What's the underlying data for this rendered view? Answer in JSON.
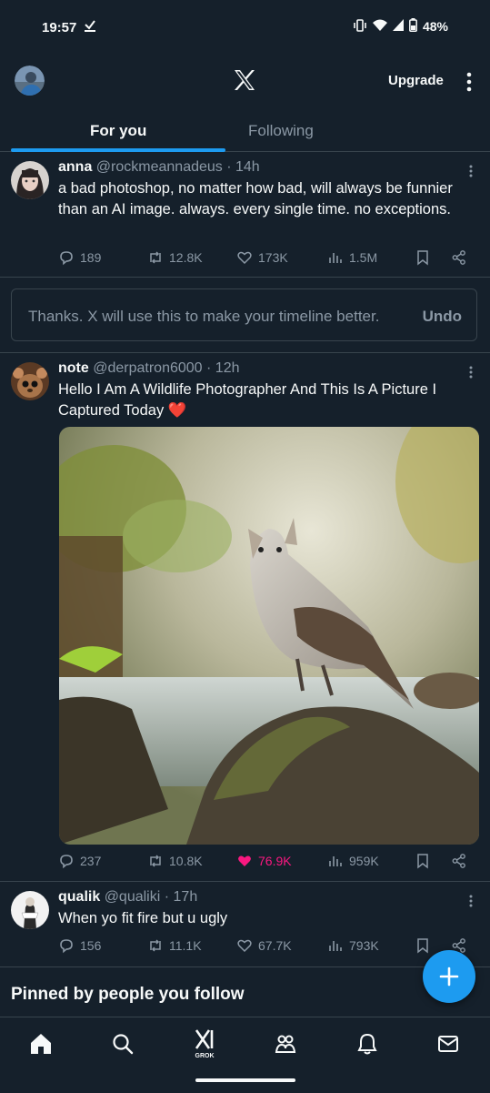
{
  "status_bar": {
    "time": "19:57",
    "battery": "48%"
  },
  "header": {
    "upgrade_label": "Upgrade"
  },
  "tabs": [
    {
      "label": "For you",
      "active": true
    },
    {
      "label": "Following",
      "active": false
    }
  ],
  "posts": [
    {
      "name": "anna",
      "handle": "@rockmeannadeus",
      "time": "· 14h",
      "text": "a bad photoshop, no matter how bad, will always be funnier than an AI image. always. every single time. no exceptions.",
      "replies": "189",
      "reposts": "12.8K",
      "likes": "173K",
      "views": "1.5M"
    },
    {
      "name": "note",
      "handle": "@derpatron6000",
      "time": "· 12h",
      "text": "Hello I Am A Wildlife Photographer And This Is A Picture I Captured Today ❤️",
      "replies": "237",
      "reposts": "10.8K",
      "likes": "76.9K",
      "views": "959K",
      "liked": true
    },
    {
      "name": "qualik",
      "handle": "@qualiki",
      "time": "· 17h",
      "text": "When yo fit fire but u ugly",
      "replies": "156",
      "reposts": "11.1K",
      "likes": "67.7K",
      "views": "793K"
    }
  ],
  "feedback": {
    "message": "Thanks. X will use this to make your timeline better.",
    "undo_label": "Undo"
  },
  "pinned_section": {
    "title": "Pinned by people you follow"
  },
  "bottom_nav": {
    "grok_label": "GROK"
  },
  "colors": {
    "background": "#15202b",
    "accent": "#1d9bf0",
    "like": "#f91880",
    "muted": "#8b98a5",
    "border": "#38444d"
  },
  "icons": [
    "download-icon",
    "vibrate-icon",
    "wifi-icon",
    "signal-icon",
    "battery-icon",
    "x-logo-icon",
    "more-vertical-icon",
    "reply-icon",
    "repost-icon",
    "like-icon",
    "views-icon",
    "bookmark-icon",
    "share-icon",
    "plus-icon",
    "home-icon",
    "search-icon",
    "grok-icon",
    "communities-icon",
    "notifications-icon",
    "messages-icon"
  ]
}
